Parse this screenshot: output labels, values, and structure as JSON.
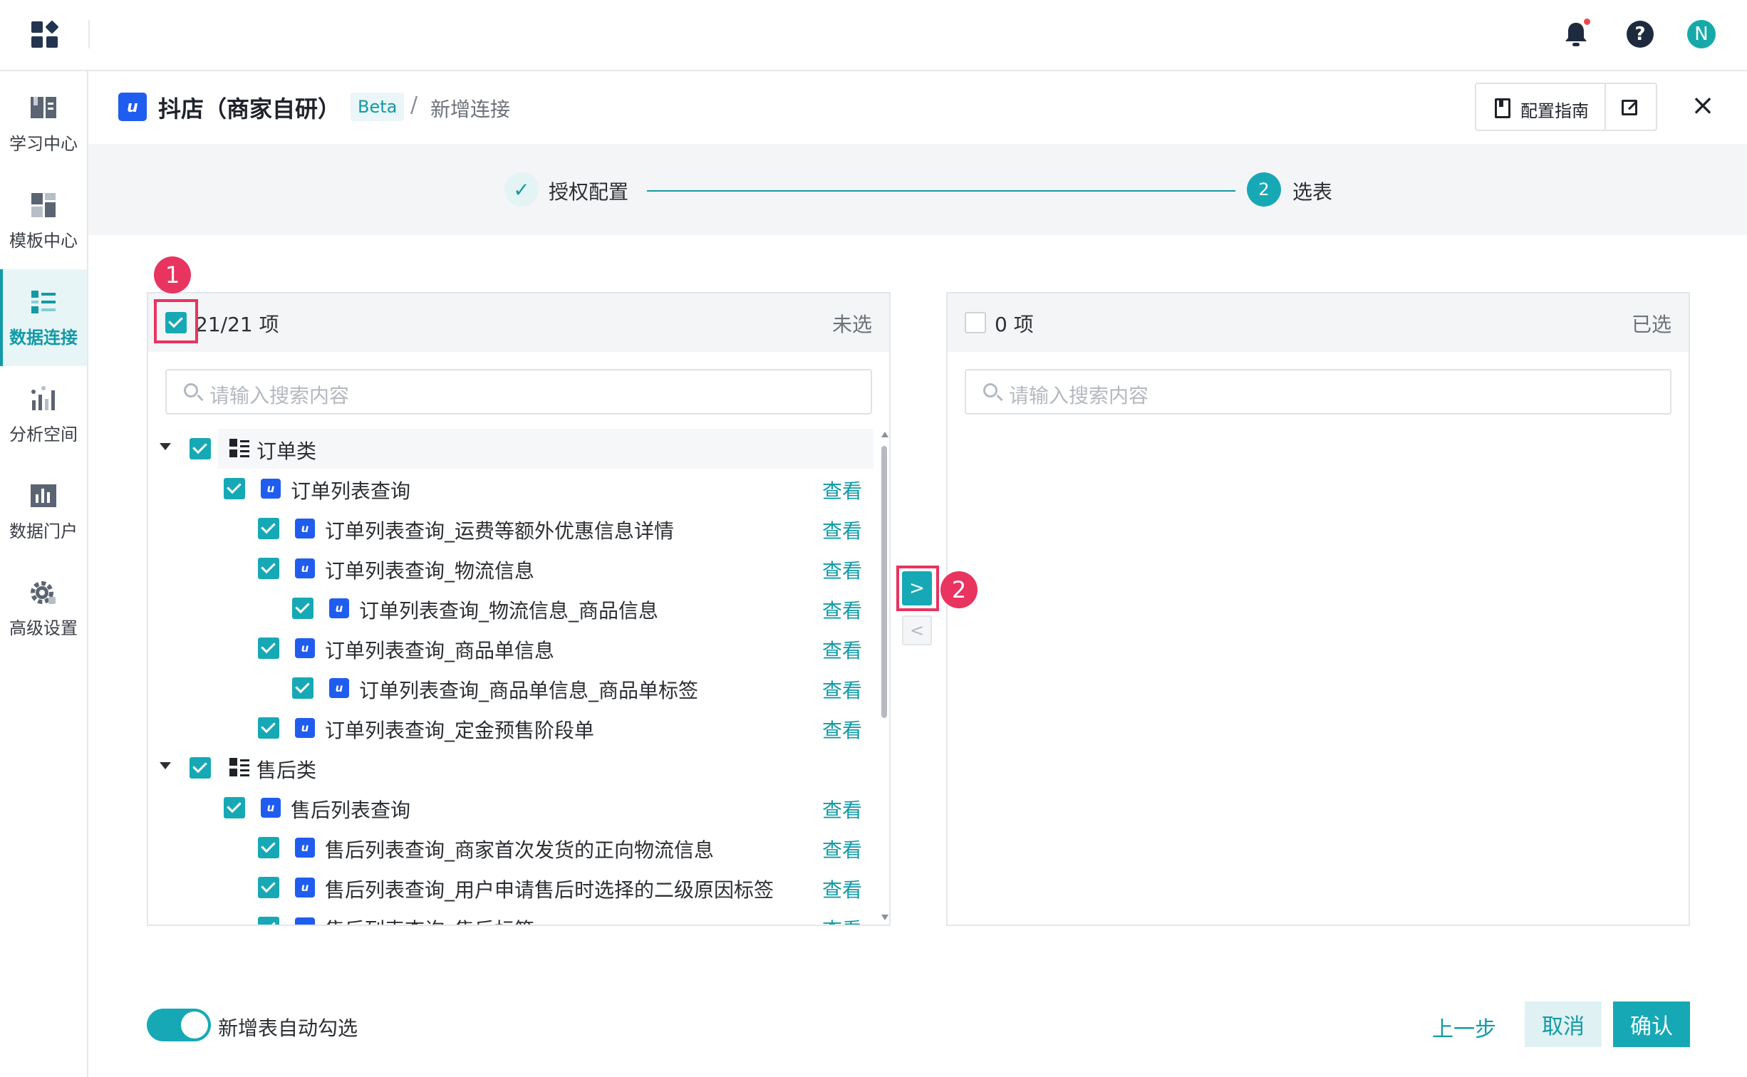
{
  "topbar": {
    "avatar_initial": "N"
  },
  "sidebar": {
    "items": [
      {
        "label": "学习中心",
        "icon": "book-icon"
      },
      {
        "label": "模板中心",
        "icon": "template-icon"
      },
      {
        "label": "数据连接",
        "icon": "data-connect-icon",
        "active": true
      },
      {
        "label": "分析空间",
        "icon": "analysis-icon"
      },
      {
        "label": "数据门户",
        "icon": "portal-chart-icon"
      },
      {
        "label": "高级设置",
        "icon": "gear-icon"
      }
    ]
  },
  "header": {
    "title": "抖店（商家自研）",
    "badge": "Beta",
    "separator": "/",
    "breadcrumb": "新增连接",
    "guide_label": "配置指南"
  },
  "steps": {
    "step1_label": "授权配置",
    "step2_number": "2",
    "step2_label": "选表"
  },
  "left_panel": {
    "count": "21/21 项",
    "state": "未选",
    "search_placeholder": "请输入搜索内容",
    "view_label": "查看",
    "rows": [
      {
        "label": "订单类",
        "type": "group"
      },
      {
        "label": "订单列表查询",
        "type": "table",
        "level": 1
      },
      {
        "label": "订单列表查询_运费等额外优惠信息详情",
        "type": "table",
        "level": 2
      },
      {
        "label": "订单列表查询_物流信息",
        "type": "table",
        "level": 2
      },
      {
        "label": "订单列表查询_物流信息_商品信息",
        "type": "table",
        "level": 3
      },
      {
        "label": "订单列表查询_商品单信息",
        "type": "table",
        "level": 2
      },
      {
        "label": "订单列表查询_商品单信息_商品单标签",
        "type": "table",
        "level": 3
      },
      {
        "label": "订单列表查询_定金预售阶段单",
        "type": "table",
        "level": 2
      },
      {
        "label": "售后类",
        "type": "group"
      },
      {
        "label": "售后列表查询",
        "type": "table",
        "level": 1
      },
      {
        "label": "售后列表查询_商家首次发货的正向物流信息",
        "type": "table",
        "level": 2
      },
      {
        "label": "售后列表查询_用户申请售后时选择的二级原因标签",
        "type": "table",
        "level": 2
      },
      {
        "label": "售后列表查询_售后标签",
        "type": "table",
        "level": 2
      }
    ]
  },
  "right_panel": {
    "count": "0 项",
    "state": "已选",
    "search_placeholder": "请输入搜索内容"
  },
  "transfer": {
    "to_right": ">",
    "to_left": "<"
  },
  "annotations": {
    "one": "1",
    "two": "2",
    "color": "#e8345f"
  },
  "footer": {
    "toggle_label": "新增表自动勾选",
    "toggle_on": true,
    "prev_label": "上一步",
    "cancel_label": "取消",
    "confirm_label": "确认"
  },
  "colors": {
    "accent": "#16a9b5",
    "brand_blue": "#1f5cf0",
    "annotation": "#e8345f"
  }
}
